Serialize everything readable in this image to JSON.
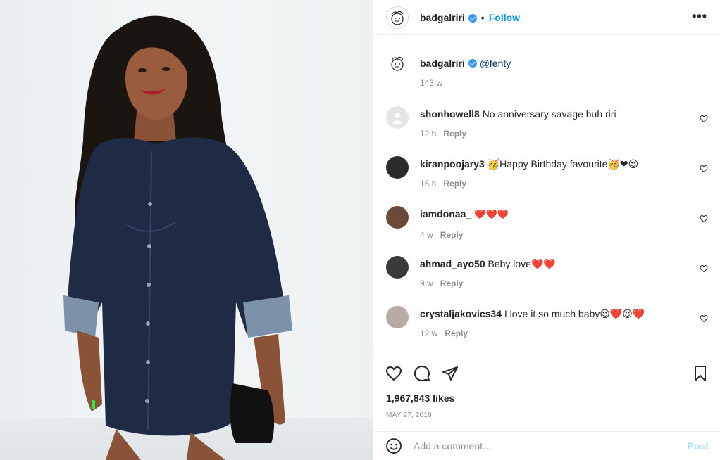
{
  "post": {
    "username": "badgalriri",
    "follow_label": "Follow",
    "dot": "•",
    "more_label": "•••",
    "caption_mention": "@fenty",
    "caption_time": "143 w",
    "likes": "1,967,843 likes",
    "date": "MAY 27, 2019"
  },
  "comments": [
    {
      "user": "shonhowell8",
      "text": " No anniversary savage huh riri",
      "time": "12 h",
      "reply": "Reply"
    },
    {
      "user": "kiranpoojary3",
      "text": " 🥳Happy Birthday favourite🥳❤😍",
      "time": "15 h",
      "reply": "Reply"
    },
    {
      "user": "iamdonaa_",
      "text": " ❤️❤️❤️",
      "time": "4 w",
      "reply": "Reply"
    },
    {
      "user": "ahmad_ayo50",
      "text": " Beby love❤️❤️",
      "time": "9 w",
      "reply": "Reply"
    },
    {
      "user": "crystaljakovics34",
      "text": " I love it so much baby😍❤️😍❤️",
      "time": "12 w",
      "reply": "Reply"
    }
  ],
  "add_comment": {
    "placeholder": "Add a comment...",
    "post_label": "Post"
  },
  "colors": {
    "accent": "#0095f6",
    "verified": "#3897f0",
    "muted": "#8e8e8e",
    "post_disabled": "#b2dffc"
  },
  "icons": [
    "heart-icon",
    "comment-icon",
    "share-icon",
    "bookmark-icon",
    "emoji-icon",
    "verified-icon",
    "more-options-icon"
  ]
}
